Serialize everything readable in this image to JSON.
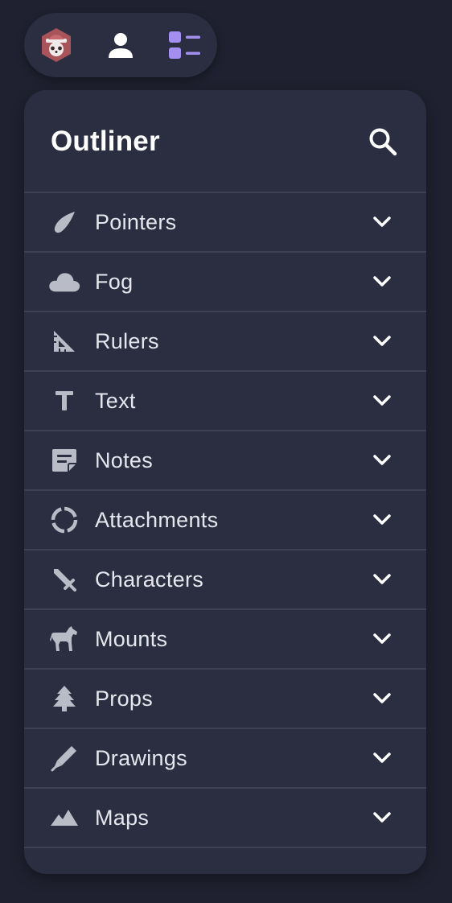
{
  "colors": {
    "background": "#1f2130",
    "panel": "#2b2e40",
    "divider": "#3d4052",
    "text": "#e6e7ee",
    "icon": "#b9bbc6",
    "accent_purple": "#a38ff0",
    "logo_red": "#a9545a"
  },
  "topbar": {
    "buttons": [
      {
        "name": "app-logo",
        "icon": "panda-logo-icon"
      },
      {
        "name": "profile",
        "icon": "user-icon"
      },
      {
        "name": "outliner",
        "icon": "outliner-list-icon",
        "active": true
      }
    ]
  },
  "outliner": {
    "title": "Outliner",
    "search_icon": "search-icon",
    "items": [
      {
        "label": "Pointers",
        "icon": "pointer-icon"
      },
      {
        "label": "Fog",
        "icon": "cloud-icon"
      },
      {
        "label": "Rulers",
        "icon": "ruler-icon"
      },
      {
        "label": "Text",
        "icon": "text-icon"
      },
      {
        "label": "Notes",
        "icon": "note-icon"
      },
      {
        "label": "Attachments",
        "icon": "attachment-icon"
      },
      {
        "label": "Characters",
        "icon": "sword-icon"
      },
      {
        "label": "Mounts",
        "icon": "horse-icon"
      },
      {
        "label": "Props",
        "icon": "tree-icon"
      },
      {
        "label": "Drawings",
        "icon": "pen-icon"
      },
      {
        "label": "Maps",
        "icon": "mountain-icon"
      }
    ]
  }
}
